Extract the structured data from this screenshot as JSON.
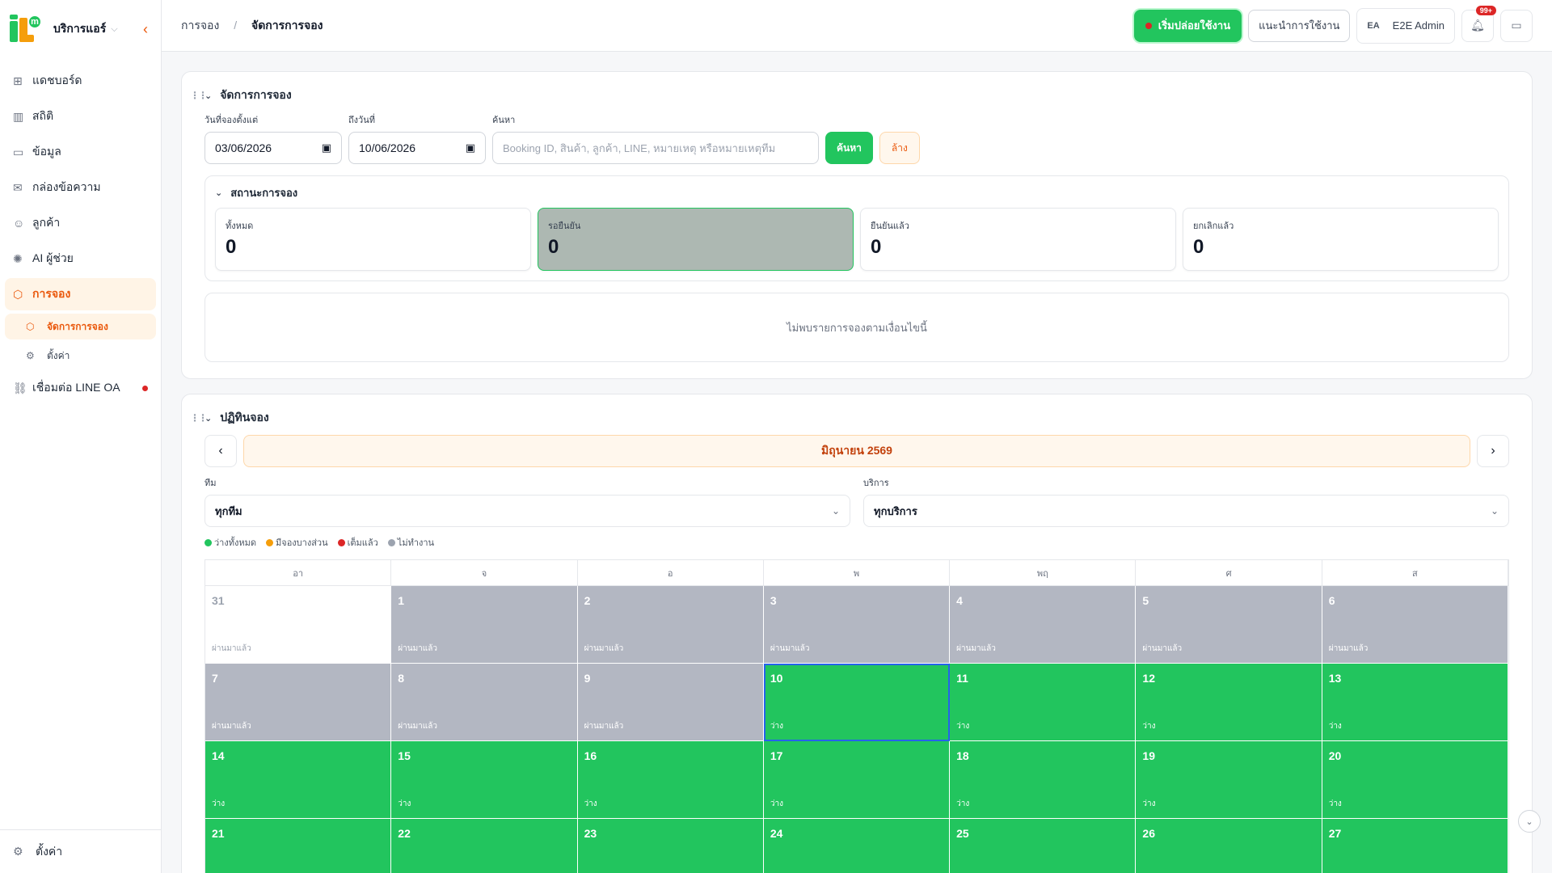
{
  "sidebar": {
    "brand": "บริการแอร์",
    "logo_letter": "m",
    "items": [
      {
        "label": "แดชบอร์ด",
        "icon": "dashboard-icon",
        "glyph": "⊞"
      },
      {
        "label": "สถิติ",
        "icon": "chart-icon",
        "glyph": "▥"
      },
      {
        "label": "ข้อมูล",
        "icon": "book-icon",
        "glyph": "▭"
      },
      {
        "label": "กล่องข้อความ",
        "icon": "inbox-icon",
        "glyph": "✉"
      },
      {
        "label": "ลูกค้า",
        "icon": "users-icon",
        "glyph": "☺"
      },
      {
        "label": "AI ผู้ช่วย",
        "icon": "ai-icon",
        "glyph": "✺"
      }
    ],
    "booking": {
      "label": "การจอง",
      "sub_manage": "จัดการการจอง",
      "sub_settings": "ตั้งค่า"
    },
    "line_oa": "เชื่อมต่อ LINE OA",
    "bottom_settings": "ตั้งค่า"
  },
  "header": {
    "breadcrumb_root": "การจอง",
    "breadcrumb_current": "จัดการการจอง",
    "start_button": "เริ่มปล่อยใช้งาน",
    "guide_button": "แนะนำการใช้งาน",
    "user_initials": "EA",
    "user_name": "E2E Admin",
    "notification_badge": "99+"
  },
  "manage": {
    "title": "จัดการการจอง",
    "date_from_label": "วันที่จองตั้งแต่",
    "date_from": "03/06/2026",
    "date_to_label": "ถึงวันที่",
    "date_to": "10/06/2026",
    "search_label": "ค้นหา",
    "search_placeholder": "Booking ID, สินค้า, ลูกค้า, LINE, หมายเหตุ หรือหมายเหตุทีม",
    "search_button": "ค้นหา",
    "clear_button": "ล้าง",
    "status_title": "สถานะการจอง",
    "stats": [
      {
        "label": "ทั้งหมด",
        "value": "0"
      },
      {
        "label": "รอยืนยัน",
        "value": "0"
      },
      {
        "label": "ยืนยันแล้ว",
        "value": "0"
      },
      {
        "label": "ยกเลิกแล้ว",
        "value": "0"
      }
    ],
    "empty_message": "ไม่พบรายการจองตามเงื่อนไขนี้"
  },
  "schedule": {
    "title": "ปฏิทินจอง",
    "month": "มิถุนายน 2569",
    "team_label": "ทีม",
    "team_value": "ทุกทีม",
    "service_label": "บริการ",
    "service_value": "ทุกบริการ",
    "legend": [
      {
        "label": "ว่างทั้งหมด",
        "color": "#22c55e"
      },
      {
        "label": "มีจองบางส่วน",
        "color": "#f59e0b"
      },
      {
        "label": "เต็มแล้ว",
        "color": "#dc2626"
      },
      {
        "label": "ไม่ทำงาน",
        "color": "#9ca3af"
      }
    ],
    "weekdays": [
      "อา",
      "จ",
      "อ",
      "พ",
      "พฤ",
      "ศ",
      "ส"
    ],
    "days": [
      {
        "n": "31",
        "s": "ผ่านมาแล้ว",
        "t": "plain"
      },
      {
        "n": "1",
        "s": "ผ่านมาแล้ว",
        "t": "past"
      },
      {
        "n": "2",
        "s": "ผ่านมาแล้ว",
        "t": "past"
      },
      {
        "n": "3",
        "s": "ผ่านมาแล้ว",
        "t": "past"
      },
      {
        "n": "4",
        "s": "ผ่านมาแล้ว",
        "t": "past"
      },
      {
        "n": "5",
        "s": "ผ่านมาแล้ว",
        "t": "past"
      },
      {
        "n": "6",
        "s": "ผ่านมาแล้ว",
        "t": "past"
      },
      {
        "n": "7",
        "s": "ผ่านมาแล้ว",
        "t": "past"
      },
      {
        "n": "8",
        "s": "ผ่านมาแล้ว",
        "t": "past"
      },
      {
        "n": "9",
        "s": "ผ่านมาแล้ว",
        "t": "past"
      },
      {
        "n": "10",
        "s": "ว่าง",
        "t": "today"
      },
      {
        "n": "11",
        "s": "ว่าง",
        "t": "free"
      },
      {
        "n": "12",
        "s": "ว่าง",
        "t": "free"
      },
      {
        "n": "13",
        "s": "ว่าง",
        "t": "free"
      },
      {
        "n": "14",
        "s": "ว่าง",
        "t": "free"
      },
      {
        "n": "15",
        "s": "ว่าง",
        "t": "free"
      },
      {
        "n": "16",
        "s": "ว่าง",
        "t": "free"
      },
      {
        "n": "17",
        "s": "ว่าง",
        "t": "free"
      },
      {
        "n": "18",
        "s": "ว่าง",
        "t": "free"
      },
      {
        "n": "19",
        "s": "ว่าง",
        "t": "free"
      },
      {
        "n": "20",
        "s": "ว่าง",
        "t": "free"
      },
      {
        "n": "21",
        "s": "",
        "t": "free"
      },
      {
        "n": "22",
        "s": "",
        "t": "free"
      },
      {
        "n": "23",
        "s": "",
        "t": "free"
      },
      {
        "n": "24",
        "s": "",
        "t": "free"
      },
      {
        "n": "25",
        "s": "",
        "t": "free"
      },
      {
        "n": "26",
        "s": "",
        "t": "free"
      },
      {
        "n": "27",
        "s": "",
        "t": "free"
      }
    ]
  }
}
